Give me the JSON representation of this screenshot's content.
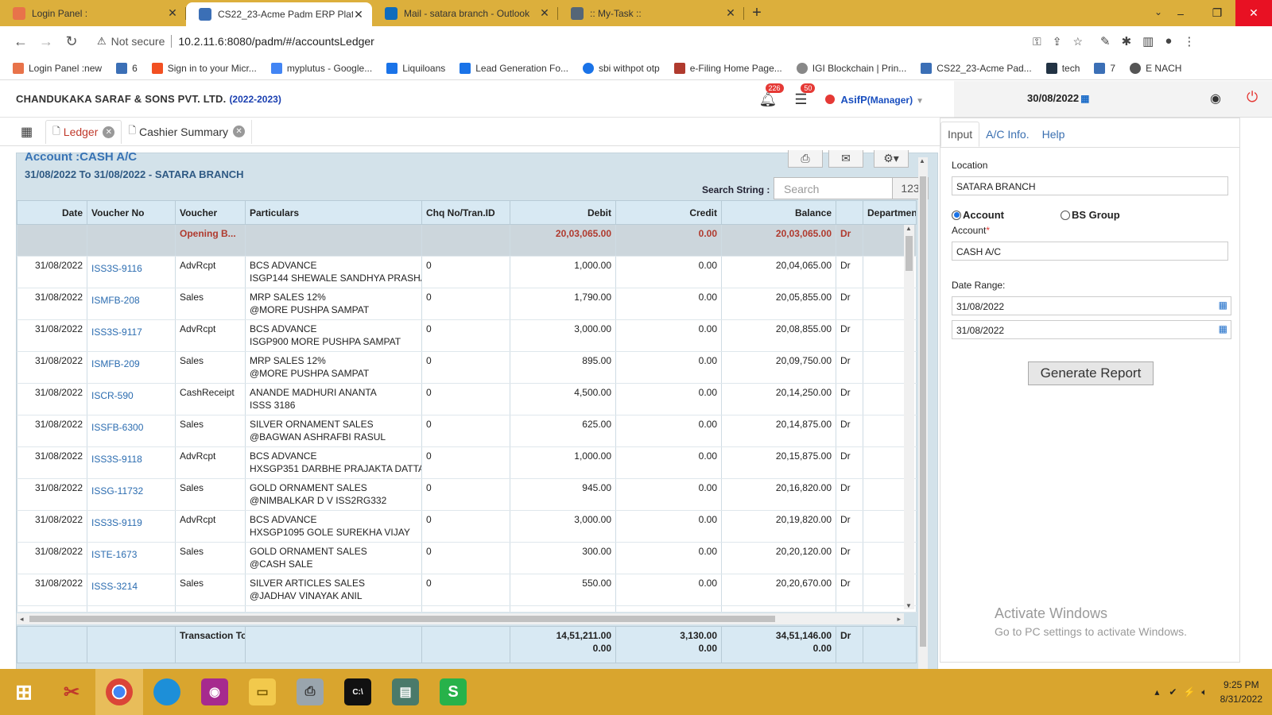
{
  "browser": {
    "tabs": [
      {
        "title": "Login Panel :",
        "active": false,
        "color": "#e8734a"
      },
      {
        "title": "CS22_23-Acme Padm ERP Platfor",
        "active": true,
        "color": "#3b6fb6"
      },
      {
        "title": "Mail - satara branch - Outlook",
        "active": false,
        "color": "#0f6cbd"
      },
      {
        "title": ":: My-Task ::",
        "active": false,
        "color": "#556677"
      }
    ],
    "not_secure": "Not secure",
    "url": "10.2.11.6:8080/padm/#/accountsLedger",
    "bookmarks": [
      {
        "label": "Login Panel :new",
        "color": "#e8734a"
      },
      {
        "label": "6",
        "color": "#3b6fb6"
      },
      {
        "label": "Sign in to your Micr...",
        "color": "#f25022"
      },
      {
        "label": "myplutus - Google...",
        "color": "#4285f4"
      },
      {
        "label": "Liquiloans",
        "color": "#1a73e8"
      },
      {
        "label": "Lead Generation Fo...",
        "color": "#1a73e8"
      },
      {
        "label": "sbi withpot otp",
        "color": "#1a73e8"
      },
      {
        "label": "e-Filing Home Page...",
        "color": "#b03a2e"
      },
      {
        "label": "IGI Blockchain | Prin...",
        "color": "#888888"
      },
      {
        "label": "CS22_23-Acme Pad...",
        "color": "#3b6fb6"
      },
      {
        "label": "tech",
        "color": "#223344"
      },
      {
        "label": "7",
        "color": "#3b6fb6"
      },
      {
        "label": "E NACH",
        "color": "#555555"
      }
    ]
  },
  "header": {
    "company": "CHANDUKAKA SARAF & SONS PVT. LTD.",
    "year": "(2022-2023)",
    "notif_count": "226",
    "msg_count": "50",
    "user": "AsifP",
    "role": "(Manager)",
    "date": "30/08/2022"
  },
  "app_tabs": [
    {
      "label": "Ledger",
      "active": true
    },
    {
      "label": "Cashier Summary",
      "active": false
    }
  ],
  "ledger": {
    "account_title": "Account :CASH A/C",
    "subtitle": "31/08/2022 To 31/08/2022 - SATARA BRANCH",
    "search_label": "Search String :",
    "search_placeholder": "Search",
    "count": "123",
    "columns": [
      "Date",
      "Voucher No",
      "Voucher",
      "Particulars",
      "Chq No/Tran.ID",
      "Debit",
      "Credit",
      "Balance",
      "",
      "Departmen"
    ],
    "opening": {
      "label": "Opening B...",
      "debit": "20,03,065.00",
      "credit": "0.00",
      "balance": "20,03,065.00",
      "drcr": "Dr"
    },
    "rows": [
      {
        "date": "31/08/2022",
        "vno": "ISS3S-9116",
        "voucher": "AdvRcpt",
        "p1": "BCS ADVANCE",
        "p2": "ISGP144 SHEWALE SANDHYA PRASHA",
        "chq": "0",
        "debit": "1,000.00",
        "credit": "0.00",
        "balance": "20,04,065.00",
        "drcr": "Dr"
      },
      {
        "date": "31/08/2022",
        "vno": "ISMFB-208",
        "voucher": "Sales",
        "p1": "MRP SALES 12%",
        "p2": "@MORE PUSHPA SAMPAT",
        "chq": "0",
        "debit": "1,790.00",
        "credit": "0.00",
        "balance": "20,05,855.00",
        "drcr": "Dr"
      },
      {
        "date": "31/08/2022",
        "vno": "ISS3S-9117",
        "voucher": "AdvRcpt",
        "p1": "BCS ADVANCE",
        "p2": "ISGP900 MORE PUSHPA SAMPAT",
        "chq": "0",
        "debit": "3,000.00",
        "credit": "0.00",
        "balance": "20,08,855.00",
        "drcr": "Dr"
      },
      {
        "date": "31/08/2022",
        "vno": "ISMFB-209",
        "voucher": "Sales",
        "p1": "MRP SALES 12%",
        "p2": "@MORE PUSHPA SAMPAT",
        "chq": "0",
        "debit": "895.00",
        "credit": "0.00",
        "balance": "20,09,750.00",
        "drcr": "Dr"
      },
      {
        "date": "31/08/2022",
        "vno": "ISCR-590",
        "voucher": "CashReceipt",
        "p1": "ANANDE MADHURI ANANTA",
        "p2": "ISSS 3186",
        "chq": "0",
        "debit": "4,500.00",
        "credit": "0.00",
        "balance": "20,14,250.00",
        "drcr": "Dr"
      },
      {
        "date": "31/08/2022",
        "vno": "ISSFB-6300",
        "voucher": "Sales",
        "p1": "SILVER ORNAMENT SALES",
        "p2": "@BAGWAN ASHRAFBI RASUL",
        "chq": "0",
        "debit": "625.00",
        "credit": "0.00",
        "balance": "20,14,875.00",
        "drcr": "Dr"
      },
      {
        "date": "31/08/2022",
        "vno": "ISS3S-9118",
        "voucher": "AdvRcpt",
        "p1": "BCS ADVANCE",
        "p2": "HXSGP351 DARBHE PRAJAKTA DATTA",
        "chq": "0",
        "debit": "1,000.00",
        "credit": "0.00",
        "balance": "20,15,875.00",
        "drcr": "Dr"
      },
      {
        "date": "31/08/2022",
        "vno": "ISSG-11732",
        "voucher": "Sales",
        "p1": "GOLD ORNAMENT SALES",
        "p2": "@NIMBALKAR D V ISS2RG332",
        "chq": "0",
        "debit": "945.00",
        "credit": "0.00",
        "balance": "20,16,820.00",
        "drcr": "Dr"
      },
      {
        "date": "31/08/2022",
        "vno": "ISS3S-9119",
        "voucher": "AdvRcpt",
        "p1": "BCS ADVANCE",
        "p2": "HXSGP1095 GOLE SUREKHA VIJAY",
        "chq": "0",
        "debit": "3,000.00",
        "credit": "0.00",
        "balance": "20,19,820.00",
        "drcr": "Dr"
      },
      {
        "date": "31/08/2022",
        "vno": "ISTE-1673",
        "voucher": "Sales",
        "p1": "GOLD ORNAMENT SALES",
        "p2": "@CASH SALE",
        "chq": "0",
        "debit": "300.00",
        "credit": "0.00",
        "balance": "20,20,120.00",
        "drcr": "Dr"
      },
      {
        "date": "31/08/2022",
        "vno": "ISSS-3214",
        "voucher": "Sales",
        "p1": "SILVER ARTICLES SALES",
        "p2": "@JADHAV VINAYAK ANIL",
        "chq": "0",
        "debit": "550.00",
        "credit": "0.00",
        "balance": "20,20,670.00",
        "drcr": "Dr"
      }
    ],
    "footer": {
      "label": "Transaction To",
      "debit1": "14,51,211.00",
      "debit2": "0.00",
      "credit1": "3,130.00",
      "credit2": "0.00",
      "bal1": "34,51,146.00",
      "bal2": "0.00",
      "drcr": "Dr"
    }
  },
  "panel": {
    "tabs": [
      "Input",
      "A/C Info.",
      "Help"
    ],
    "location_label": "Location",
    "location_value": "SATARA BRANCH",
    "radio_account": "Account",
    "radio_bs": "BS Group",
    "account_label": "Account",
    "account_req": "*",
    "account_value": "CASH A/C",
    "date_range_label": "Date Range:",
    "date_from": "31/08/2022",
    "date_to": "31/08/2022",
    "generate": "Generate Report"
  },
  "watermark": {
    "line1": "Activate Windows",
    "line2": "Go to PC settings to activate Windows."
  },
  "taskbar": {
    "time": "9:25 PM",
    "date": "8/31/2022"
  }
}
